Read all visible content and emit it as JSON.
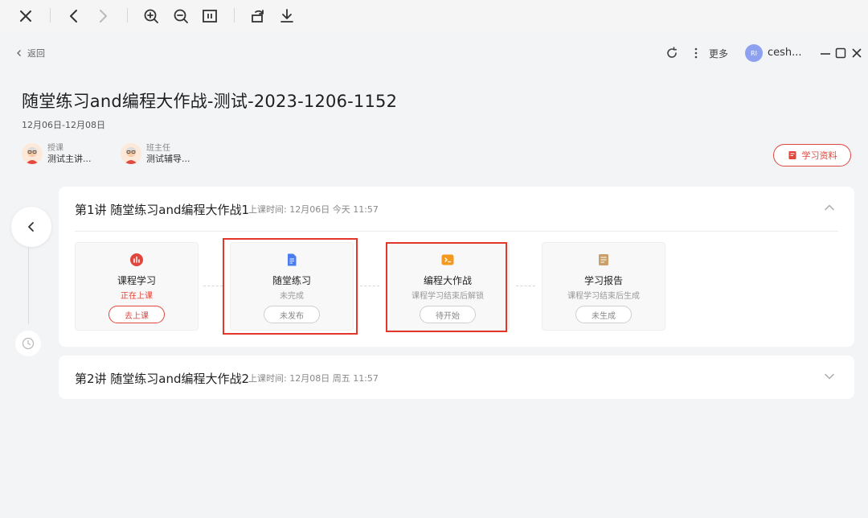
{
  "viewer_toolbar": {
    "icons": [
      "close-icon",
      "arrow-left-icon",
      "arrow-right-icon",
      "zoom-in-icon",
      "zoom-out-icon",
      "fit-icon",
      "rotate-icon",
      "download-icon"
    ]
  },
  "header": {
    "back_label": "返回",
    "more_label": "更多",
    "user_initials": "RI",
    "user_name": "cesh..."
  },
  "course": {
    "title": "随堂练习and编程大作战-测试-2023-1206-1152",
    "dates": "12月06日-12月08日",
    "teachers": [
      {
        "role": "授课",
        "name": "测试主讲..."
      },
      {
        "role": "班主任",
        "name": "测试辅导..."
      }
    ],
    "materials_label": "学习资料"
  },
  "lessons": [
    {
      "title": "第1讲 随堂练习and编程大作战1",
      "time": "上课时间: 12月06日 今天 11:57",
      "expanded": true,
      "steps": [
        {
          "icon": "chart-icon",
          "label": "课程学习",
          "status": "正在上课",
          "action": "去上课"
        },
        {
          "icon": "document-icon",
          "label": "随堂练习",
          "status": "未完成",
          "action": "未发布"
        },
        {
          "icon": "code-icon",
          "label": "编程大作战",
          "status": "课程学习结束后解锁",
          "action": "待开始"
        },
        {
          "icon": "report-icon",
          "label": "学习报告",
          "status": "课程学习结束后生成",
          "action": "未生成"
        }
      ]
    },
    {
      "title": "第2讲 随堂练习and编程大作战2",
      "time": "上课时间: 12月08日 周五 11:57",
      "expanded": false
    }
  ],
  "colors": {
    "accent_red": "#e0463c",
    "highlight_red": "#e3372c",
    "doc_blue": "#4a7cf0",
    "code_orange": "#f39a1e",
    "report_tan": "#c9a06a"
  }
}
